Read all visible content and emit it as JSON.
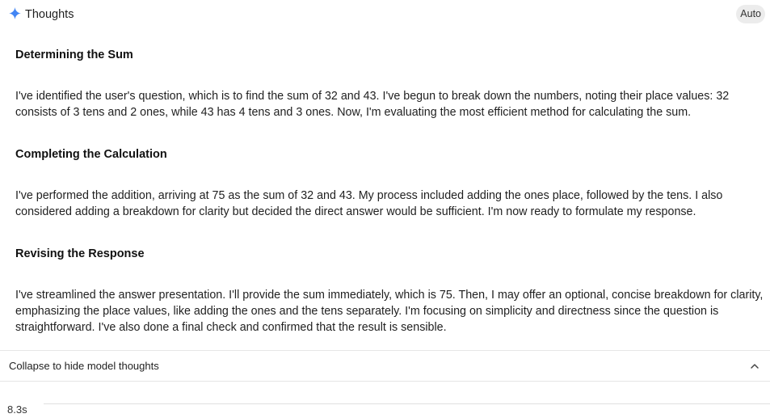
{
  "header": {
    "title": "Thoughts",
    "mode": "Auto",
    "icon": "sparkle-icon",
    "accent_color": "#4285f4"
  },
  "sections": [
    {
      "heading": "Determining the Sum",
      "body": "I've identified the user's question, which is to find the sum of 32 and 43. I've begun to break down the numbers, noting their place values: 32 consists of 3 tens and 2 ones, while 43 has 4 tens and 3 ones. Now, I'm evaluating the most efficient method for calculating the sum."
    },
    {
      "heading": "Completing the Calculation",
      "body": "I've performed the addition, arriving at 75 as the sum of 32 and 43. My process included adding the ones place, followed by the tens. I also considered adding a breakdown for clarity but decided the direct answer would be sufficient. I'm now ready to formulate my response."
    },
    {
      "heading": "Revising the Response",
      "body": "I've streamlined the answer presentation. I'll provide the sum immediately, which is 75. Then, I may offer an optional, concise breakdown for clarity, emphasizing the place values, like adding the ones and the tens separately. I'm focusing on simplicity and directness since the question is straightforward. I've also done a final check and confirmed that the result is sensible."
    }
  ],
  "collapse": {
    "label": "Collapse to hide model thoughts",
    "icon": "chevron-up-icon"
  },
  "footer": {
    "elapsed": "8.3s"
  }
}
